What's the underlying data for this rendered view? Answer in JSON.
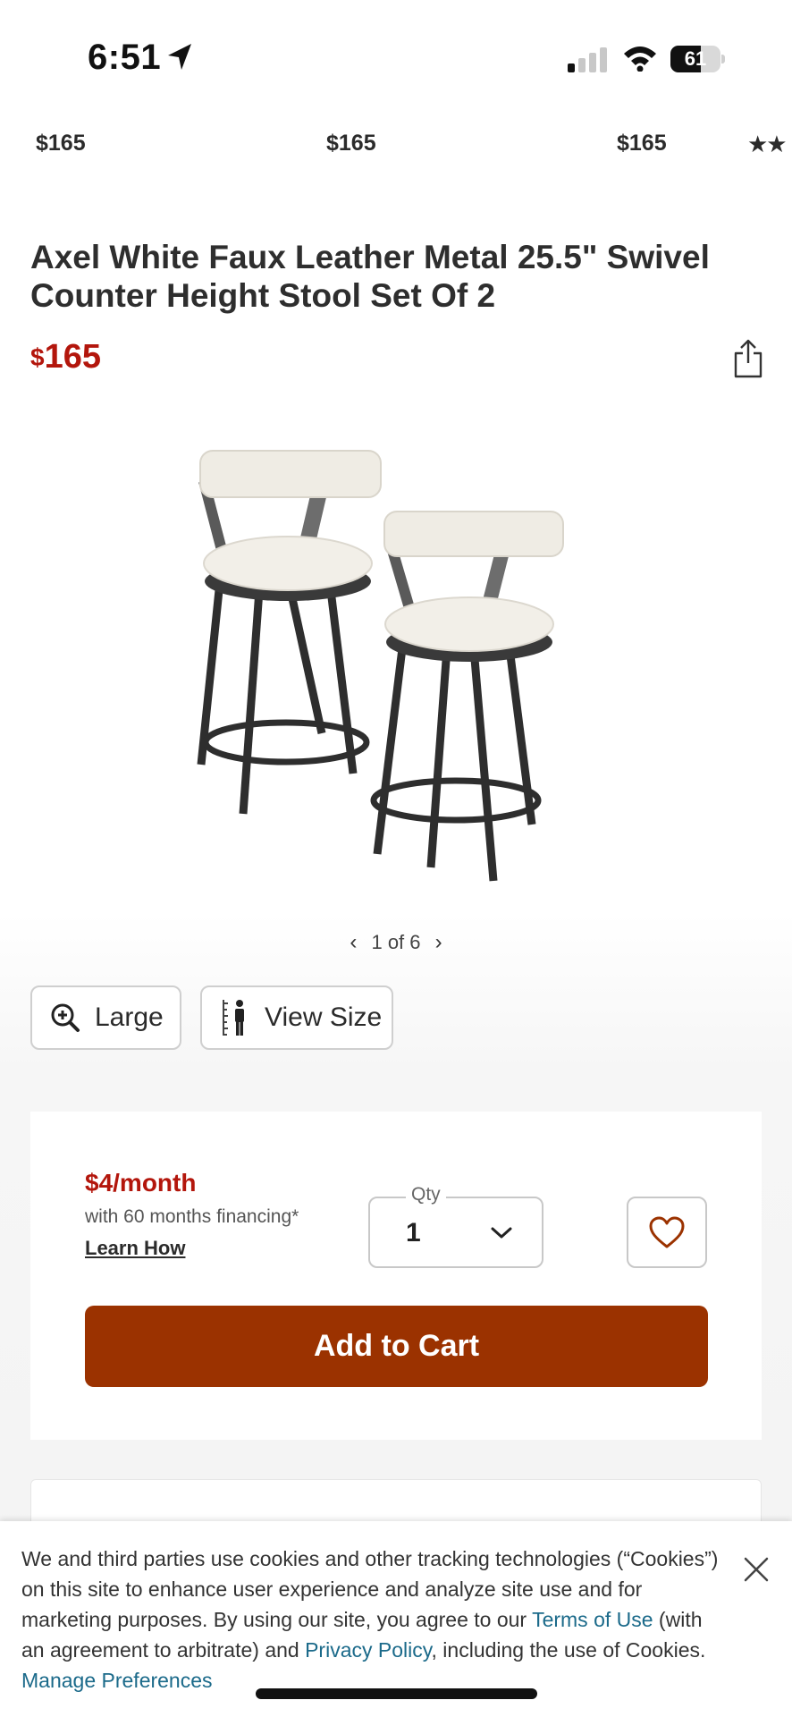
{
  "status_bar": {
    "time": "6:51",
    "battery": "61",
    "battery_level": 0.61
  },
  "related_prices": [
    "$165",
    "$165",
    "$165"
  ],
  "related_stars": "★★",
  "product": {
    "title": "Axel White Faux Leather Metal 25.5\" Swivel Counter Height Stool Set Of 2",
    "price_currency": "$",
    "price_amount": "165"
  },
  "gallery": {
    "pager": "1 of 6",
    "large_label": "Large",
    "view_size_label": "View Size"
  },
  "purchase": {
    "financing_price": "$4/month",
    "financing_note": "with 60 months financing*",
    "learn_how": "Learn How",
    "qty_label": "Qty",
    "qty_value": "1",
    "add_to_cart": "Add to Cart"
  },
  "cookie_banner": {
    "text_1": "We and third parties use cookies and other tracking technologies (“Cookies”) on this site to enhance user experience and analyze site use and for marketing purposes. By using our site, you agree to our ",
    "terms_link": "Terms of Use",
    "text_2": " (with an agreement to arbitrate) and ",
    "privacy_link": "Privacy Policy",
    "text_3": ", including the use of Cookies. ",
    "manage_link": "Manage Preferences"
  },
  "colors": {
    "accent_red": "#b3160c",
    "cart_button": "#9b3200",
    "link_blue": "#1b6a8a"
  },
  "icons": [
    "location-arrow-icon",
    "cell-signal-icon",
    "wifi-icon",
    "battery-icon",
    "share-icon",
    "zoom-in-icon",
    "ruler-person-icon",
    "chevron-left-icon",
    "chevron-right-icon",
    "chevron-down-icon",
    "heart-icon",
    "close-icon"
  ]
}
